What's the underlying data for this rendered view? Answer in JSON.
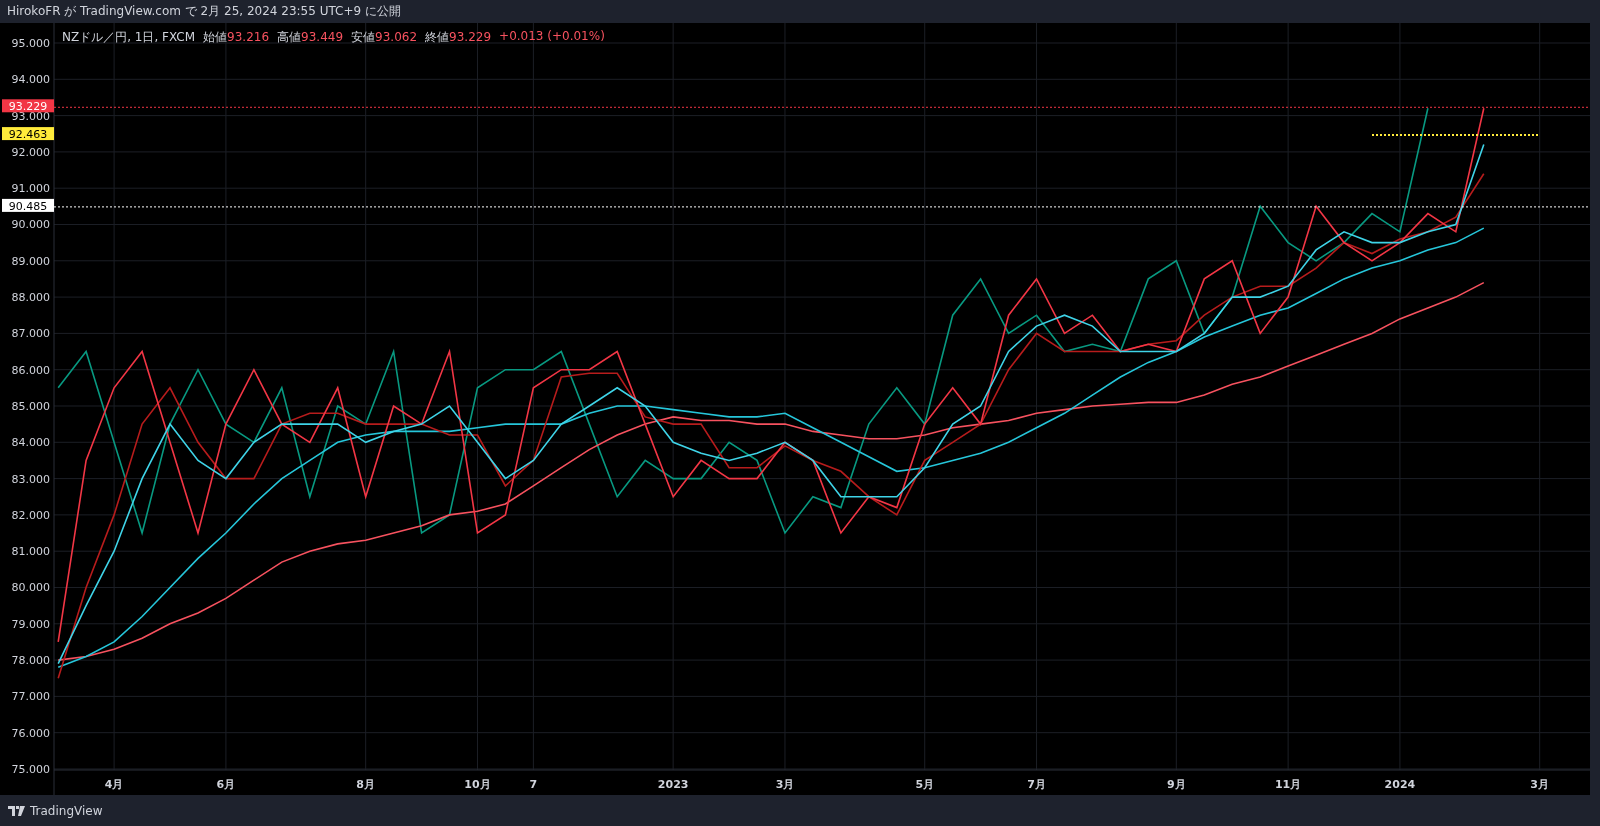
{
  "header": {
    "text": "HirokoFR が TradingView.com で 2月 25, 2024 23:55 UTC+9 に公開"
  },
  "legend": {
    "symbol": "NZドル／円, 1日, FXCM",
    "fields": [
      {
        "label": "始値",
        "value": "93.216"
      },
      {
        "label": "高値",
        "value": "93.449"
      },
      {
        "label": "安値",
        "value": "93.062"
      },
      {
        "label": "終値",
        "value": "93.229"
      }
    ],
    "change": "+0.013 (+0.01%)"
  },
  "chart_data": {
    "type": "line",
    "categories": [
      null,
      null,
      "4月",
      null,
      null,
      null,
      "6月",
      null,
      null,
      null,
      null,
      "8月",
      null,
      null,
      null,
      "10月",
      null,
      "7",
      null,
      null,
      null,
      null,
      "2023",
      null,
      null,
      null,
      "3月",
      null,
      null,
      null,
      null,
      "5月",
      null,
      null,
      null,
      "7月",
      null,
      null,
      null,
      null,
      "9月",
      null,
      null,
      null,
      "11月",
      null,
      null,
      null,
      "2024",
      null,
      null,
      null,
      null,
      "3月"
    ],
    "grid": true,
    "ylim": [
      74.972,
      95.551
    ],
    "yticks": [
      {
        "value": 75,
        "label": "75.000"
      },
      {
        "value": 76,
        "label": "76.000"
      },
      {
        "value": 77,
        "label": "77.000"
      },
      {
        "value": 78,
        "label": "78.000"
      },
      {
        "value": 79,
        "label": "79.000"
      },
      {
        "value": 80,
        "label": "80.000"
      },
      {
        "value": 81,
        "label": "81.000"
      },
      {
        "value": 82,
        "label": "82.000"
      },
      {
        "value": 83,
        "label": "83.000"
      },
      {
        "value": 84,
        "label": "84.000"
      },
      {
        "value": 85,
        "label": "85.000"
      },
      {
        "value": 86,
        "label": "86.000"
      },
      {
        "value": 87,
        "label": "87.000"
      },
      {
        "value": 88,
        "label": "88.000"
      },
      {
        "value": 89,
        "label": "89.000"
      },
      {
        "value": 90,
        "label": "90.000"
      },
      {
        "value": 91,
        "label": "91.000"
      },
      {
        "value": 92,
        "label": "92.000"
      },
      {
        "value": 93,
        "label": "93.000"
      },
      {
        "value": 94,
        "label": "94.000"
      },
      {
        "value": 95,
        "label": "95.000"
      }
    ],
    "series": [
      {
        "color": "#089981",
        "values": [
          85.5,
          86.5,
          84,
          81.5,
          84.5,
          86,
          84.5,
          84,
          85.5,
          82.5,
          85,
          84.5,
          86.5,
          81.5,
          82,
          85.5,
          86,
          86,
          86.5,
          84.5,
          82.5,
          83.5,
          83,
          83,
          84,
          83.5,
          81.5,
          82.5,
          82.2,
          84.5,
          85.5,
          84.5,
          87.5,
          88.5,
          87,
          87.5,
          86.5,
          86.7,
          86.5,
          88.5,
          89,
          87,
          88,
          90.5,
          89.5,
          89,
          89.5,
          90.3,
          89.8,
          93.2,
          null,
          null,
          null,
          null
        ]
      },
      {
        "color": "#f7525f",
        "values": [
          78,
          78.1,
          78.3,
          78.6,
          79,
          79.3,
          79.7,
          80.2,
          80.7,
          81,
          81.2,
          81.3,
          81.5,
          81.7,
          82,
          82.1,
          82.3,
          82.8,
          83.3,
          83.8,
          84.2,
          84.5,
          84.7,
          84.6,
          84.6,
          84.5,
          84.5,
          84.3,
          84.2,
          84.1,
          84.1,
          84.2,
          84.4,
          84.5,
          84.6,
          84.8,
          84.9,
          85,
          85.05,
          85.1,
          85.1,
          85.3,
          85.6,
          85.8,
          86.1,
          86.4,
          86.7,
          87,
          87.4,
          87.7,
          88,
          88.4,
          null,
          null
        ]
      },
      {
        "color": "#26c6da",
        "values": [
          77.8,
          78.1,
          78.5,
          79.2,
          80,
          80.8,
          81.5,
          82.3,
          83,
          83.5,
          84,
          84.2,
          84.3,
          84.3,
          84.3,
          84.4,
          84.5,
          84.5,
          84.5,
          84.8,
          85,
          85,
          84.9,
          84.8,
          84.7,
          84.7,
          84.8,
          84.4,
          84,
          83.6,
          83.2,
          83.3,
          83.5,
          83.7,
          84,
          84.4,
          84.8,
          85.3,
          85.8,
          86.2,
          86.5,
          86.9,
          87.2,
          87.5,
          87.7,
          88.1,
          88.5,
          88.8,
          89,
          89.3,
          89.5,
          89.9,
          null,
          null
        ]
      },
      {
        "color": "#b71c1c",
        "values": [
          77.5,
          80,
          82,
          84.5,
          85.5,
          84,
          83,
          83,
          84.5,
          84.8,
          84.8,
          84.5,
          84.5,
          84.5,
          84.2,
          84.2,
          82.8,
          83.5,
          85.8,
          85.9,
          85.9,
          84.7,
          84.5,
          84.5,
          83.3,
          83.3,
          83.9,
          83.5,
          83.2,
          82.5,
          82,
          83.5,
          84,
          84.5,
          86,
          87,
          86.5,
          86.5,
          86.5,
          86.7,
          86.8,
          87.5,
          88,
          88.3,
          88.3,
          88.8,
          89.5,
          89.2,
          89.6,
          89.8,
          90.2,
          91.4,
          null,
          null
        ]
      },
      {
        "color": "#f23645",
        "values": [
          78.5,
          83.5,
          85.5,
          86.5,
          84,
          81.5,
          84.5,
          86,
          84.5,
          84,
          85.5,
          82.5,
          85,
          84.5,
          86.5,
          81.5,
          82,
          85.5,
          86,
          86,
          86.5,
          84.5,
          82.5,
          83.5,
          83,
          83,
          84,
          83.5,
          81.5,
          82.5,
          82.2,
          84.5,
          85.5,
          84.5,
          87.5,
          88.5,
          87,
          87.5,
          86.5,
          86.7,
          86.5,
          88.5,
          89,
          87,
          88,
          90.5,
          89.5,
          89,
          89.5,
          90.3,
          89.8,
          93.2,
          null,
          null
        ]
      },
      {
        "color": "#ffeb3b",
        "line_style": "dotted",
        "values": [
          null,
          null,
          null,
          null,
          null,
          null,
          null,
          null,
          null,
          null,
          null,
          null,
          null,
          null,
          null,
          null,
          null,
          null,
          null,
          null,
          null,
          null,
          null,
          null,
          null,
          null,
          null,
          null,
          null,
          null,
          null,
          null,
          null,
          null,
          null,
          null,
          null,
          null,
          null,
          null,
          null,
          null,
          null,
          null,
          null,
          null,
          null,
          92.463,
          92.463,
          92.463,
          92.463,
          92.463,
          92.463,
          92.463
        ]
      },
      {
        "color": "#3fd4e8",
        "values": [
          77.9,
          79.5,
          81,
          83,
          84.5,
          83.5,
          83,
          84,
          84.5,
          84.5,
          84.5,
          84,
          84.3,
          84.5,
          85,
          84,
          83,
          83.5,
          84.5,
          85,
          85.5,
          85,
          84,
          83.7,
          83.5,
          83.7,
          84,
          83.5,
          82.5,
          82.5,
          82.5,
          83.3,
          84.5,
          85,
          86.5,
          87.2,
          87.5,
          87.2,
          86.5,
          86.5,
          86.5,
          87,
          88,
          88,
          88.3,
          89.3,
          89.8,
          89.5,
          89.5,
          89.8,
          90,
          92.2,
          null,
          null
        ]
      }
    ],
    "ref_lines": [
      {
        "axis": "y",
        "value": 93.229,
        "label": "93.229",
        "color": "#f23645"
      },
      {
        "axis": "y",
        "value": 90.485,
        "label": "90.485",
        "color": "#ffffff"
      }
    ]
  },
  "level_line": {
    "label": "92.463",
    "color": "#ffeb3b"
  },
  "footer": {
    "brand": "TradingView"
  }
}
